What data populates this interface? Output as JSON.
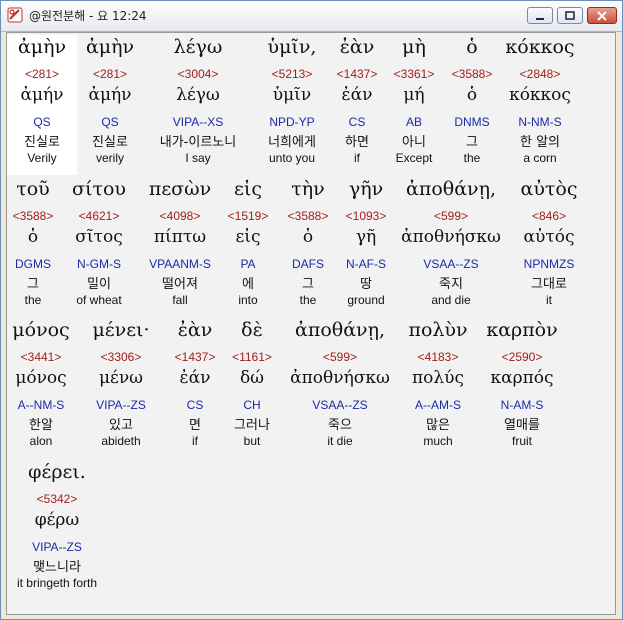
{
  "window": {
    "title": "@원전분해 - 요 12:24"
  },
  "rows": [
    [
      {
        "greek": "ἀμὴν",
        "strong": "<281>",
        "lemma": "ἀμήν",
        "morph": "QS",
        "korean": "진실로",
        "english": "Verily"
      },
      {
        "greek": "ἀμὴν",
        "strong": "<281>",
        "lemma": "ἀμήν",
        "morph": "QS",
        "korean": "진실로",
        "english": "verily"
      },
      {
        "greek": "λέγω",
        "strong": "<3004>",
        "lemma": "λέγω",
        "morph": "VIPA--XS",
        "korean": "내가-이르노니",
        "english": "I say"
      },
      {
        "greek": "ὑμῖν,",
        "strong": "<5213>",
        "lemma": "ὑμῖν",
        "morph": "NPD-YP",
        "korean": "너희에게",
        "english": "unto you"
      },
      {
        "greek": "ἐὰν",
        "strong": "<1437>",
        "lemma": "ἐάν",
        "morph": "CS",
        "korean": "하면",
        "english": "if"
      },
      {
        "greek": "μὴ",
        "strong": "<3361>",
        "lemma": "μή",
        "morph": "AB",
        "korean": "아니",
        "english": "Except"
      },
      {
        "greek": "ὁ",
        "strong": "<3588>",
        "lemma": "ὁ",
        "morph": "DNMS",
        "korean": "그",
        "english": "the"
      },
      {
        "greek": "κόκκος",
        "strong": "<2848>",
        "lemma": "κόκκος",
        "morph": "N-NM-S",
        "korean": "한 알의",
        "english": "a corn"
      }
    ],
    [
      {
        "greek": "τοῦ",
        "strong": "<3588>",
        "lemma": "ὁ",
        "morph": "DGMS",
        "korean": "그",
        "english": "the"
      },
      {
        "greek": "σίτου",
        "strong": "<4621>",
        "lemma": "σῖτος",
        "morph": "N-GM-S",
        "korean": "밀이",
        "english": "of wheat"
      },
      {
        "greek": "πεσὼν",
        "strong": "<4098>",
        "lemma": "πίπτω",
        "morph": "VPAANM-S",
        "korean": "떨어져",
        "english": "fall"
      },
      {
        "greek": "εἰς",
        "strong": "<1519>",
        "lemma": "εἰς",
        "morph": "PA",
        "korean": "에",
        "english": "into"
      },
      {
        "greek": "τὴν",
        "strong": "<3588>",
        "lemma": "ὁ",
        "morph": "DAFS",
        "korean": "그",
        "english": "the"
      },
      {
        "greek": "γῆν",
        "strong": "<1093>",
        "lemma": "γῆ",
        "morph": "N-AF-S",
        "korean": "땅",
        "english": "ground"
      },
      {
        "greek": "ἀποθάνῃ,",
        "strong": "<599>",
        "lemma": "ἀποθνήσκω",
        "morph": "VSAA--ZS",
        "korean": "죽지",
        "english": "and die"
      },
      {
        "greek": "αὐτὸς",
        "strong": "<846>",
        "lemma": "αὐτός",
        "morph": "NPNMZS",
        "korean": "그대로",
        "english": "it"
      }
    ],
    [
      {
        "greek": "μόνος",
        "strong": "<3441>",
        "lemma": "μόνος",
        "morph": "A--NM-S",
        "korean": "한알",
        "english": "alon"
      },
      {
        "greek": "μένει·",
        "strong": "<3306>",
        "lemma": "μένω",
        "morph": "VIPA--ZS",
        "korean": "있고",
        "english": "abideth"
      },
      {
        "greek": "ἐὰν",
        "strong": "<1437>",
        "lemma": "ἐάν",
        "morph": "CS",
        "korean": "면",
        "english": "if"
      },
      {
        "greek": "δὲ",
        "strong": "<1161>",
        "lemma": "δώ",
        "morph": "CH",
        "korean": "그러나",
        "english": "but"
      },
      {
        "greek": "ἀποθάνῃ,",
        "strong": "<599>",
        "lemma": "ἀποθνήσκω",
        "morph": "VSAA--ZS",
        "korean": "죽으",
        "english": "it die"
      },
      {
        "greek": "πολὺν",
        "strong": "<4183>",
        "lemma": "πολύς",
        "morph": "A--AM-S",
        "korean": "많은",
        "english": "much"
      },
      {
        "greek": "καρπὸν",
        "strong": "<2590>",
        "lemma": "καρπός",
        "morph": "N-AM-S",
        "korean": "열매를",
        "english": "fruit"
      }
    ],
    [
      {
        "greek": "φέρει.",
        "strong": "<5342>",
        "lemma": "φέρω",
        "morph": "VIPA--ZS",
        "korean": "맺느니라",
        "english": "it bringeth forth"
      }
    ]
  ]
}
